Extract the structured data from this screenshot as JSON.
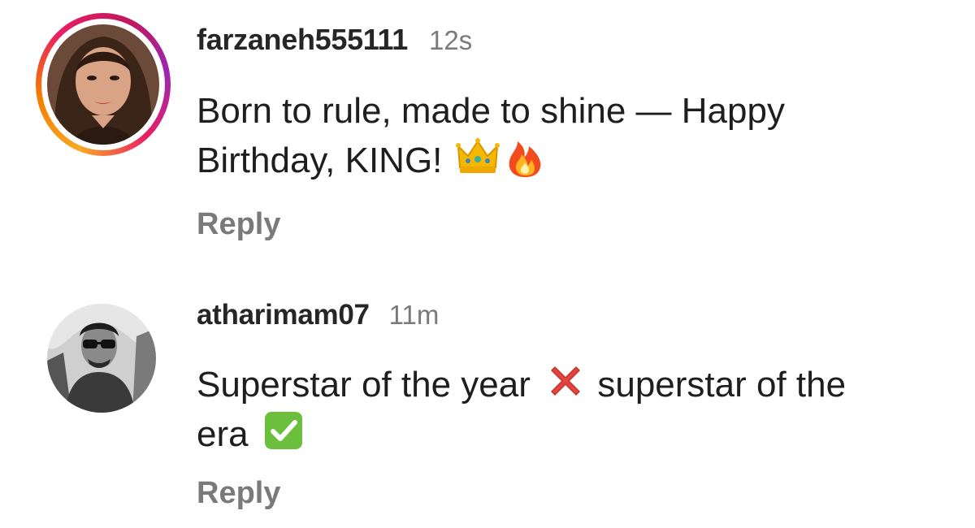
{
  "comments": [
    {
      "username": "farzaneh555111",
      "timestamp": "12s",
      "text_part1": "Born to rule, made to shine — Happy Birthday, KING!",
      "emoji_1": "crown-emoji",
      "emoji_2": "fire-emoji",
      "reply_label": "Reply",
      "has_story_ring": true
    },
    {
      "username": "atharimam07",
      "timestamp": "11m",
      "text_part1": "Superstar of the year",
      "emoji_1": "cross-mark-emoji",
      "text_part2": "superstar of the era",
      "emoji_2": "check-mark-emoji",
      "reply_label": "Reply",
      "has_story_ring": false
    }
  ],
  "colors": {
    "username": "#262626",
    "timestamp": "#7a7a7a",
    "reply": "#7a7a7a",
    "story_ring_start": "#f9a825",
    "story_ring_end": "#9c27b0",
    "cross": "#e0463f",
    "check": "#6cbf3c"
  }
}
